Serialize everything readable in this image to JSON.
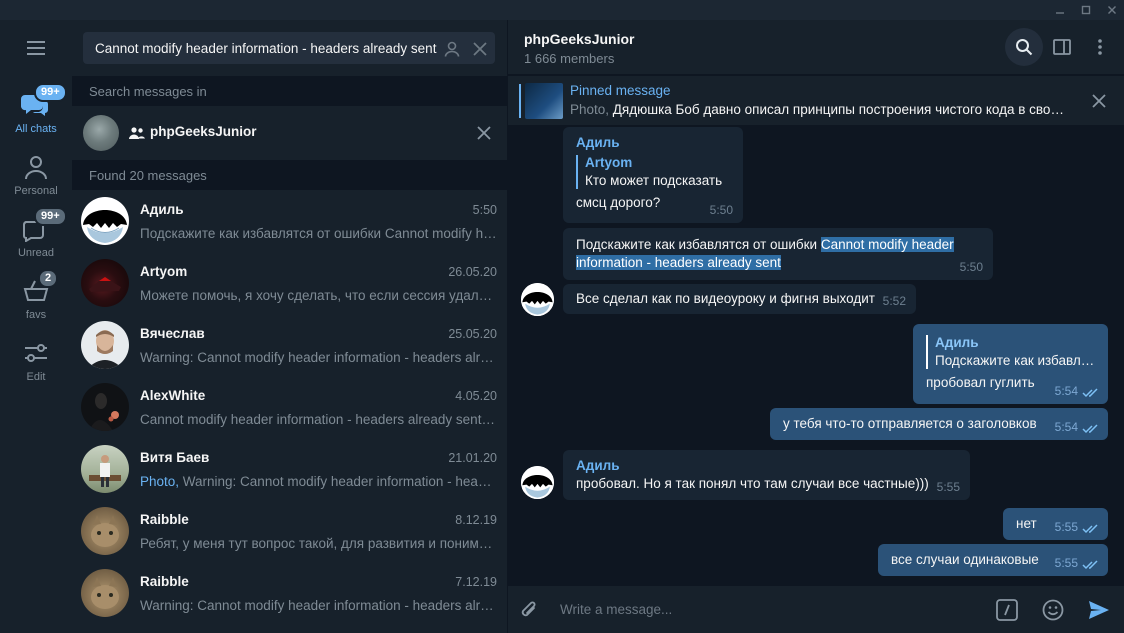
{
  "window": {
    "controls": [
      "minimize",
      "maximize",
      "close"
    ]
  },
  "folders": [
    {
      "label": "All chats",
      "badge": "99+",
      "icon": "chat-bubbles-icon",
      "active": true
    },
    {
      "label": "Personal",
      "badge": "",
      "icon": "person-icon"
    },
    {
      "label": "Unread",
      "badge": "99+",
      "icon": "unread-chat-icon"
    },
    {
      "label": "favs",
      "badge": "2",
      "icon": "basket-icon"
    },
    {
      "label": "Edit",
      "badge": "",
      "icon": "sliders-icon"
    }
  ],
  "search": {
    "query": "Cannot modify header information - headers already sent",
    "messages_in_header": "Search messages in",
    "chat_name": "phpGeeksJunior",
    "found_header": "Found 20 messages"
  },
  "results": [
    {
      "name": "Адиль",
      "date": "5:50",
      "prefix": "",
      "text": "Подскажите как избавлятся от ошибки Cannot modify header information - headers already sent"
    },
    {
      "name": "Artyom",
      "date": "26.05.20",
      "prefix": "",
      "text": "Можете помочь, я хочу сделать, что если сессия удалена, то перекидывало на главную"
    },
    {
      "name": "Вячеслав",
      "date": "25.05.20",
      "prefix": "",
      "text": "Warning: Cannot modify header information - headers already sent by"
    },
    {
      "name": "AlexWhite",
      "date": "4.05.20",
      "prefix": "",
      "text": "Cannot modify header information - headers already sent by (output started at"
    },
    {
      "name": "Витя Баев",
      "date": "21.01.20",
      "prefix": "Photo, ",
      "text": "Warning: Cannot modify header information - headers already sent"
    },
    {
      "name": "Raibble",
      "date": "8.12.19",
      "prefix": "",
      "text": "Ребят, у меня тут вопрос такой, для развития и понимания"
    },
    {
      "name": "Raibble",
      "date": "7.12.19",
      "prefix": "",
      "text": "Warning: Cannot modify header information - headers already sent"
    }
  ],
  "chat": {
    "title": "phpGeeksJunior",
    "subtitle": "1 666 members",
    "pinned_title": "Pinned message",
    "pinned_type": "Photo, ",
    "pinned_text": "Дядюшка Боб давно описал принципы построения чистого кода в своей книге",
    "composer_placeholder": "Write a message..."
  },
  "messages": [
    {
      "dir": "in",
      "sender": "Адиль",
      "reply_name": "Artyom",
      "reply_text": "Кто может подсказать",
      "text": "смсц дорого?",
      "time": "5:50"
    },
    {
      "dir": "in",
      "text_plain": "Подскажите как избавлятся от ошибки ",
      "text_sel1": "Cannot modify header",
      "text_sel2": "information - headers already sent",
      "time": "5:50"
    },
    {
      "dir": "in",
      "text": "Все сделал как по видеоуроку и фигня выходит",
      "time": "5:52"
    },
    {
      "dir": "out",
      "reply_name": "Адиль",
      "reply_text": "Подскажите как избавлятся",
      "text": "пробовал гуглить",
      "time": "5:54"
    },
    {
      "dir": "out",
      "text": "у тебя что-то отправляется о заголовков",
      "time": "5:54"
    },
    {
      "dir": "in",
      "sender": "Адиль",
      "text": "пробовал. Но я так понял что там случаи все частные)))",
      "time": "5:55"
    },
    {
      "dir": "out",
      "text": "нет",
      "time": "5:55"
    },
    {
      "dir": "out",
      "text": "все случаи одинаковые",
      "time": "5:55"
    }
  ],
  "colors": {
    "accent": "#6ab2f2",
    "outgoing": "#2b5278",
    "incoming": "#182533",
    "panel": "#17212b",
    "background": "#0e1621"
  }
}
